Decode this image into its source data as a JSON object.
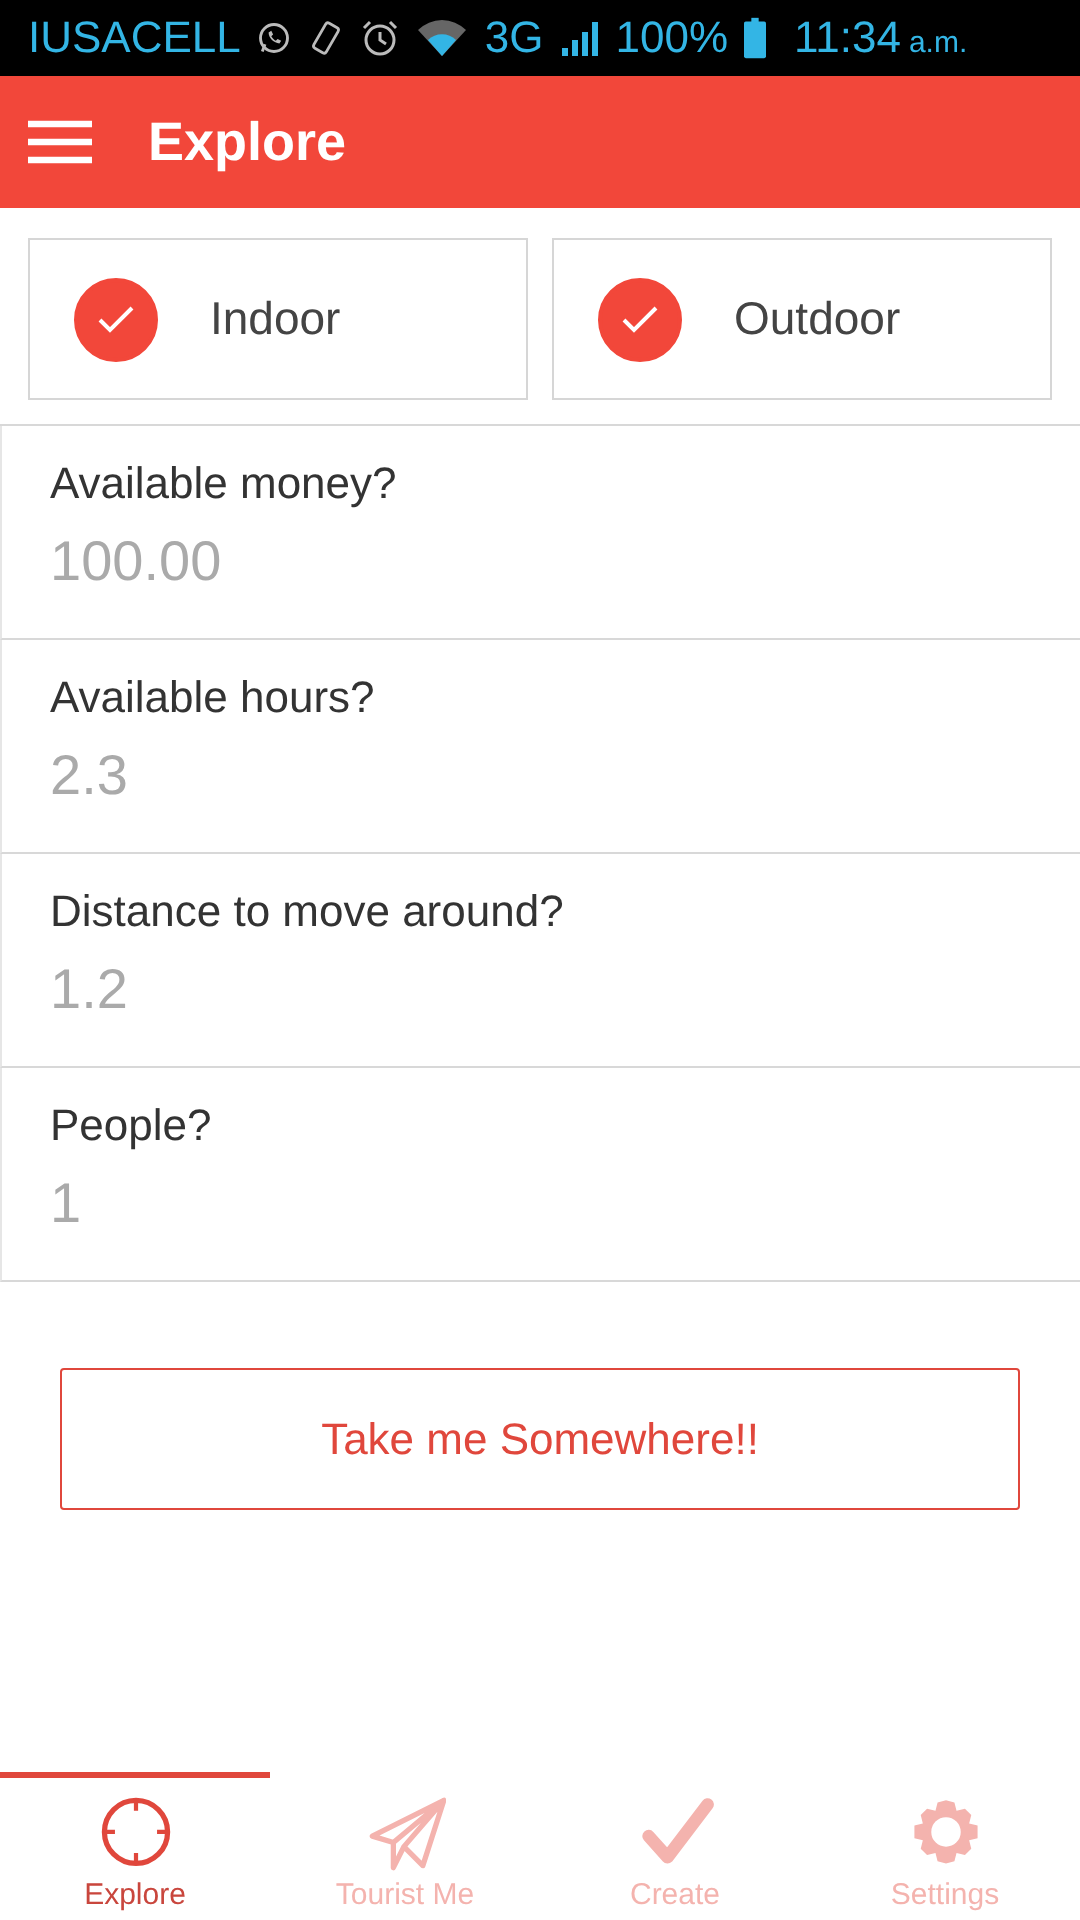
{
  "status_bar": {
    "carrier": "IUSACELL",
    "network": "3G",
    "battery": "100%",
    "time": "11:34",
    "period": "a.m."
  },
  "header": {
    "title": "Explore"
  },
  "filters": [
    {
      "label": "Indoor",
      "checked": true
    },
    {
      "label": "Outdoor",
      "checked": true
    }
  ],
  "fields": [
    {
      "label": "Available money?",
      "placeholder": "100.00"
    },
    {
      "label": "Available hours?",
      "placeholder": "2.3"
    },
    {
      "label": "Distance to move around?",
      "placeholder": "1.2"
    },
    {
      "label": "People?",
      "placeholder": "1"
    }
  ],
  "action_button": "Take me Somewhere!!",
  "tabs": [
    {
      "label": "Explore",
      "kind": "crosshair",
      "selected": true
    },
    {
      "label": "Tourist Me",
      "kind": "plane",
      "selected": false
    },
    {
      "label": "Create",
      "kind": "check",
      "selected": false
    },
    {
      "label": "Settings",
      "kind": "gear",
      "selected": false
    }
  ]
}
